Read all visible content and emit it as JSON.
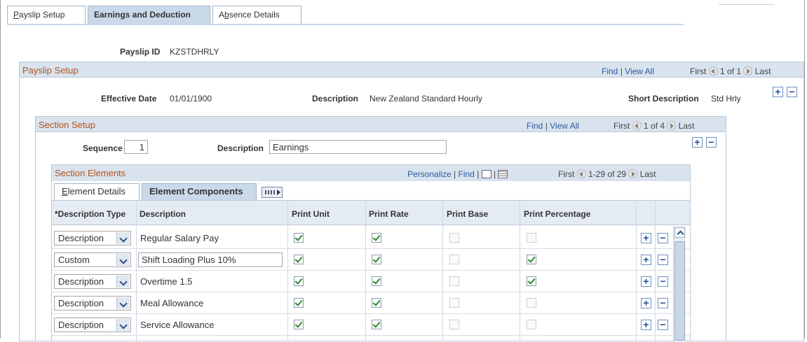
{
  "tabs": [
    {
      "label": "Payslip Setup",
      "accel": "P",
      "rest": "ayslip Setup"
    },
    {
      "label": "Earnings and Deduction"
    },
    {
      "label_pre": "A",
      "accel": "b",
      "label_post": "sence Details"
    }
  ],
  "payslip_id": {
    "label": "Payslip ID",
    "value": "KZSTDHRLY"
  },
  "payslip_setup": {
    "title": "Payslip Setup",
    "find": "Find",
    "sep": "|",
    "view_all": "View All",
    "first": "First",
    "count": "1 of 1",
    "last": "Last",
    "effective_date_label": "Effective Date",
    "effective_date": "01/01/1900",
    "description_label": "Description",
    "description": "New Zealand Standard Hourly",
    "short_desc_label": "Short Description",
    "short_desc": "Std Hrly"
  },
  "section_setup": {
    "title": "Section Setup",
    "find": "Find",
    "sep": "|",
    "view_all": "View All",
    "first": "First",
    "count": "1 of 4",
    "last": "Last",
    "sequence_label": "Sequence",
    "sequence": "1",
    "description_label": "Description",
    "description": "Earnings"
  },
  "section_elements": {
    "title": "Section Elements",
    "personalize": "Personalize",
    "find": "Find",
    "sep": "|",
    "first": "First",
    "count": "1-29 of 29",
    "last": "Last",
    "tab_details_accel": "E",
    "tab_details_rest": "lement Details",
    "tab_components": "Element Components",
    "columns": [
      "*Description Type",
      "Description",
      "Print Unit",
      "Print Rate",
      "Print Base",
      "Print Percentage"
    ],
    "rows": [
      {
        "type": "Description",
        "description": "Regular Salary Pay",
        "unit": true,
        "rate": true,
        "base": false,
        "pct": false
      },
      {
        "type": "Custom",
        "description": "Shift Loading Plus 10%",
        "unit": true,
        "rate": true,
        "base": false,
        "pct": true
      },
      {
        "type": "Description",
        "description": "Overtime 1.5",
        "unit": true,
        "rate": true,
        "base": false,
        "pct": true
      },
      {
        "type": "Description",
        "description": "Meal Allowance",
        "unit": true,
        "rate": true,
        "base": false,
        "pct": false
      },
      {
        "type": "Description",
        "description": "Service Allowance",
        "unit": true,
        "rate": true,
        "base": false,
        "pct": false
      }
    ]
  },
  "icons": {
    "add": "+",
    "remove": "−"
  }
}
